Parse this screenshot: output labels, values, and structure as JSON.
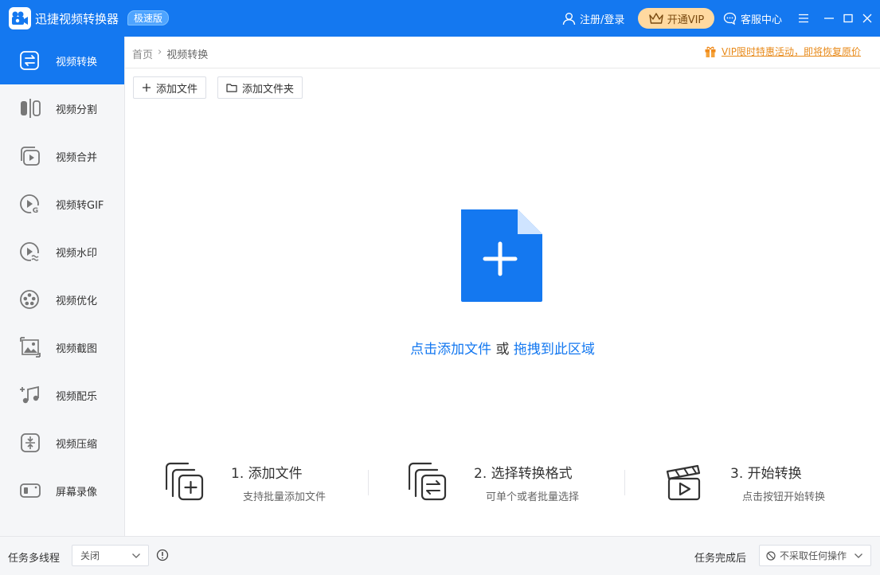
{
  "titlebar": {
    "app_name": "迅捷视频转换器",
    "edition_badge": "极速版",
    "login_label": "注册/登录",
    "vip_label": "开通VIP",
    "service_label": "客服中心"
  },
  "sidebar": {
    "items": [
      {
        "label": "视频转换",
        "icon": "video-convert-icon"
      },
      {
        "label": "视频分割",
        "icon": "video-split-icon"
      },
      {
        "label": "视频合并",
        "icon": "video-merge-icon"
      },
      {
        "label": "视频转GIF",
        "icon": "video-gif-icon"
      },
      {
        "label": "视频水印",
        "icon": "video-watermark-icon"
      },
      {
        "label": "视频优化",
        "icon": "video-optimize-icon"
      },
      {
        "label": "视频截图",
        "icon": "video-screenshot-icon"
      },
      {
        "label": "视频配乐",
        "icon": "video-music-icon"
      },
      {
        "label": "视频压缩",
        "icon": "video-compress-icon"
      },
      {
        "label": "屏幕录像",
        "icon": "screen-record-icon"
      }
    ],
    "active_index": 0
  },
  "breadcrumb": {
    "home": "首页",
    "separator": "›",
    "current": "视频转换"
  },
  "promo": {
    "text": "VIP限时特惠活动，即将恢复原价"
  },
  "toolbar": {
    "add_file_label": "添加文件",
    "add_folder_label": "添加文件夹"
  },
  "drop_zone": {
    "click_text": "点击添加文件",
    "or_text": "或",
    "drag_text": "拖拽到此区域"
  },
  "steps": [
    {
      "title": "1. 添加文件",
      "subtitle": "支持批量添加文件"
    },
    {
      "title": "2. 选择转换格式",
      "subtitle": "可单个或者批量选择"
    },
    {
      "title": "3. 开始转换",
      "subtitle": "点击按钮开始转换"
    }
  ],
  "footer": {
    "multithread_label": "任务多线程",
    "multithread_value": "关闭",
    "after_task_label": "任务完成后",
    "after_task_value": "不采取任何操作"
  },
  "colors": {
    "brand_blue": "#1478f0",
    "vip_gold": "#ffd9a0",
    "promo_orange": "#e88a1a"
  }
}
